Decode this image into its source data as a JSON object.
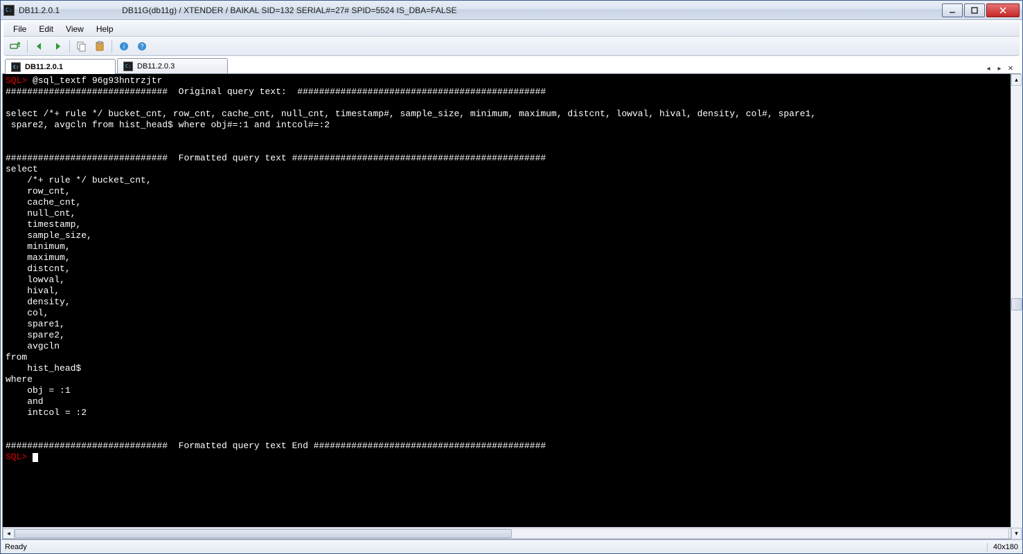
{
  "title": {
    "app_title": "DB11.2.0.1",
    "info": "DB11G(db11g) / XTENDER / BAIKAL   SID=132    SERIAL#=27#       SPID=5524      IS_DBA=FALSE"
  },
  "menu": {
    "items": [
      "File",
      "Edit",
      "View",
      "Help"
    ]
  },
  "tabs": [
    {
      "label": "DB11.2.0.1",
      "active": true
    },
    {
      "label": "DB11.2.0.3",
      "active": false
    }
  ],
  "terminal": {
    "prompt": "SQL>",
    "command": " @sql_textf 96g93hntrzjtr",
    "body": "##############################  Original query text:  ##############################################\n\nselect /*+ rule */ bucket_cnt, row_cnt, cache_cnt, null_cnt, timestamp#, sample_size, minimum, maximum, distcnt, lowval, hival, density, col#, spare1,\n spare2, avgcln from hist_head$ where obj#=:1 and intcol#=:2\n\n\n##############################  Formatted query text ###############################################\nselect\n    /*+ rule */ bucket_cnt,\n    row_cnt,\n    cache_cnt,\n    null_cnt,\n    timestamp,\n    sample_size,\n    minimum,\n    maximum,\n    distcnt,\n    lowval,\n    hival,\n    density,\n    col,\n    spare1,\n    spare2,\n    avgcln\nfrom\n    hist_head$\nwhere\n    obj = :1\n    and\n    intcol = :2\n\n\n##############################  Formatted query text End ###########################################"
  },
  "status": {
    "left": "Ready",
    "right": "40x180"
  }
}
